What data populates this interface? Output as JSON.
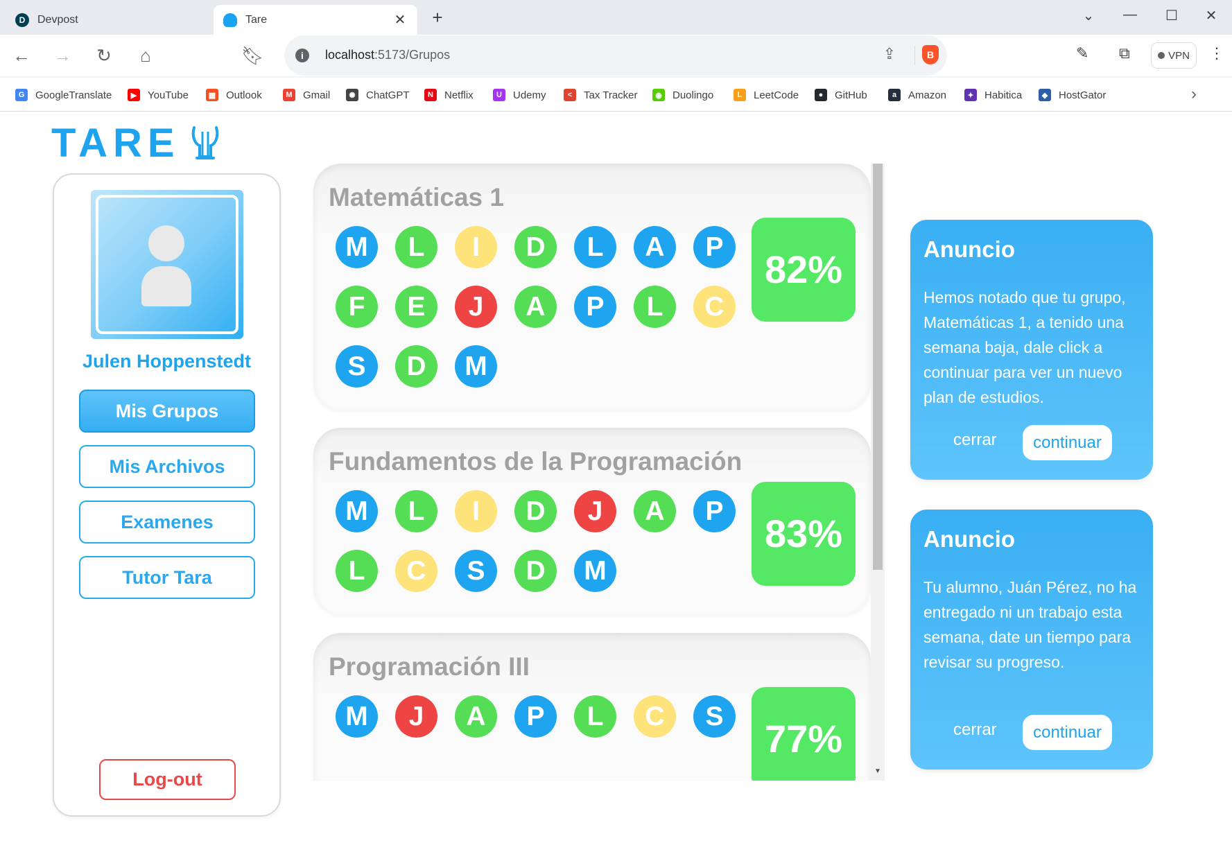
{
  "browser": {
    "tabs": [
      {
        "title": "Devpost",
        "favicon_letter": "D",
        "active": false
      },
      {
        "title": "Tare",
        "favicon_letter": "",
        "active": true
      }
    ],
    "url_host": "localhost",
    "url_path": ":5173/Grupos",
    "vpn_label": "VPN",
    "bookmarks": [
      {
        "label": "GoogleTranslate",
        "icon": "G",
        "color": "#4285f4"
      },
      {
        "label": "YouTube",
        "icon": "▶",
        "color": "#ff0000"
      },
      {
        "label": "Outlook",
        "icon": "▦",
        "color": "#f25022"
      },
      {
        "label": "Gmail",
        "icon": "M",
        "color": "#ea4335"
      },
      {
        "label": "ChatGPT",
        "icon": "✺",
        "color": "#444444"
      },
      {
        "label": "Netflix",
        "icon": "N",
        "color": "#e50914"
      },
      {
        "label": "Udemy",
        "icon": "U",
        "color": "#a435f0"
      },
      {
        "label": "Tax Tracker",
        "icon": "<",
        "color": "#e0442f"
      },
      {
        "label": "Duolingo",
        "icon": "◉",
        "color": "#58cc02"
      },
      {
        "label": "LeetCode",
        "icon": "L",
        "color": "#f89f1b"
      },
      {
        "label": "GitHub",
        "icon": "●",
        "color": "#24292f"
      },
      {
        "label": "Amazon",
        "icon": "a",
        "color": "#232f3e"
      },
      {
        "label": "Habitica",
        "icon": "✦",
        "color": "#6133b4"
      },
      {
        "label": "HostGator",
        "icon": "◆",
        "color": "#2b60a8"
      }
    ]
  },
  "app": {
    "logo_text": "TARE",
    "user_name": "Julen Hoppenstedt",
    "nav": [
      {
        "label": "Mis Grupos",
        "active": true
      },
      {
        "label": "Mis Archivos",
        "active": false
      },
      {
        "label": "Examenes",
        "active": false
      },
      {
        "label": "Tutor Tara",
        "active": false
      }
    ],
    "logout_label": "Log-out"
  },
  "colors": {
    "blue": "#1fa5ef",
    "green": "#55dd55",
    "yellow": "#fde37a",
    "red": "#ef4444",
    "progress": "#55e865"
  },
  "groups": [
    {
      "name": "Matemáticas 1",
      "progress": "82%",
      "members": [
        {
          "l": "M",
          "c": "blue"
        },
        {
          "l": "L",
          "c": "green"
        },
        {
          "l": "I",
          "c": "yellow"
        },
        {
          "l": "D",
          "c": "green"
        },
        {
          "l": "L",
          "c": "blue"
        },
        {
          "l": "A",
          "c": "blue"
        },
        {
          "l": "P",
          "c": "blue"
        },
        {
          "l": "F",
          "c": "green"
        },
        {
          "l": "E",
          "c": "green"
        },
        {
          "l": "J",
          "c": "red"
        },
        {
          "l": "A",
          "c": "green"
        },
        {
          "l": "P",
          "c": "blue"
        },
        {
          "l": "L",
          "c": "green"
        },
        {
          "l": "C",
          "c": "yellow"
        },
        {
          "l": "S",
          "c": "blue"
        },
        {
          "l": "D",
          "c": "green"
        },
        {
          "l": "M",
          "c": "blue"
        }
      ]
    },
    {
      "name": "Fundamentos de la Programación",
      "progress": "83%",
      "members": [
        {
          "l": "M",
          "c": "blue"
        },
        {
          "l": "L",
          "c": "green"
        },
        {
          "l": "I",
          "c": "yellow"
        },
        {
          "l": "D",
          "c": "green"
        },
        {
          "l": "J",
          "c": "red"
        },
        {
          "l": "A",
          "c": "green"
        },
        {
          "l": "P",
          "c": "blue"
        },
        {
          "l": "L",
          "c": "green"
        },
        {
          "l": "C",
          "c": "yellow"
        },
        {
          "l": "S",
          "c": "blue"
        },
        {
          "l": "D",
          "c": "green"
        },
        {
          "l": "M",
          "c": "blue"
        }
      ]
    },
    {
      "name": "Programación III",
      "progress": "77%",
      "members": [
        {
          "l": "M",
          "c": "blue"
        },
        {
          "l": "J",
          "c": "red"
        },
        {
          "l": "A",
          "c": "green"
        },
        {
          "l": "P",
          "c": "blue"
        },
        {
          "l": "L",
          "c": "green"
        },
        {
          "l": "C",
          "c": "yellow"
        },
        {
          "l": "S",
          "c": "blue"
        }
      ]
    }
  ],
  "announcements": [
    {
      "title": "Anuncio",
      "body": "Hemos notado que tu grupo, Matemáticas 1, a tenido una semana baja, dale click a continuar para ver un nuevo plan de estudios.",
      "close_label": "cerrar",
      "continue_label": "continuar"
    },
    {
      "title": "Anuncio",
      "body": "Tu alumno, Juán Pérez, no ha entregado ni un trabajo esta semana, date un tiempo para revisar su progreso.",
      "close_label": "cerrar",
      "continue_label": "continuar"
    }
  ]
}
